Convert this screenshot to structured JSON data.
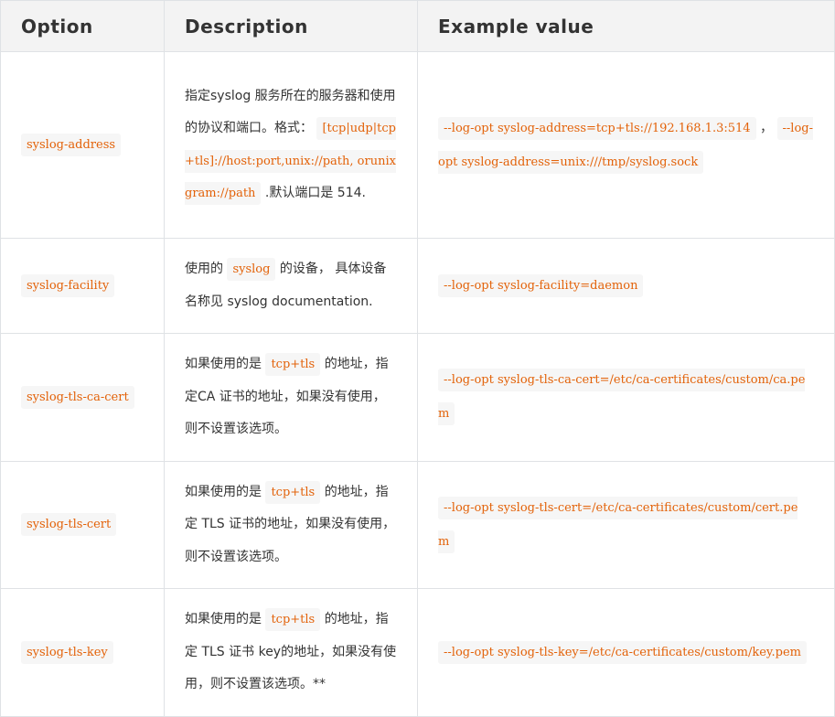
{
  "headers": [
    "Option",
    "Description",
    "Example value"
  ],
  "rows": [
    {
      "option": "syslog-address",
      "desc_pre": "指定syslog 服务所在的服务器和使用的协议和端口。格式：",
      "desc_code": "[tcp|udp|tcp+tls]://host:port,unix://path, orunixgram://path",
      "desc_post": ".默认端口是 514.",
      "example_a": "--log-opt syslog-address=tcp+tls://192.168.1.3:514",
      "example_sep": "，",
      "example_b": "--log-opt syslog-address=unix:///tmp/syslog.sock"
    },
    {
      "option": "syslog-facility",
      "desc_pre": "使用的",
      "desc_code": "syslog",
      "desc_post": "的设备， 具体设备名称见 syslog documentation.",
      "example_a": "--log-opt syslog-facility=daemon"
    },
    {
      "option": "syslog-tls-ca-cert",
      "desc_pre": "如果使用的是",
      "desc_code": "tcp+tls",
      "desc_post": "的地址，指定CA 证书的地址，如果没有使用，则不设置该选项。",
      "example_a": "--log-opt syslog-tls-ca-cert=/etc/ca-certificates/custom/ca.pem"
    },
    {
      "option": "syslog-tls-cert",
      "desc_pre": "如果使用的是",
      "desc_code": "tcp+tls",
      "desc_post": "的地址，指定 TLS 证书的地址，如果没有使用，则不设置该选项。",
      "example_a": "--log-opt syslog-tls-cert=/etc/ca-certificates/custom/cert.pem"
    },
    {
      "option": "syslog-tls-key",
      "desc_pre": "如果使用的是",
      "desc_code": "tcp+tls",
      "desc_post": "的地址，指定 TLS 证书 key的地址，如果没有使用，则不设置该选项。**",
      "example_a": "--log-opt syslog-tls-key=/etc/ca-certificates/custom/key.pem"
    }
  ]
}
